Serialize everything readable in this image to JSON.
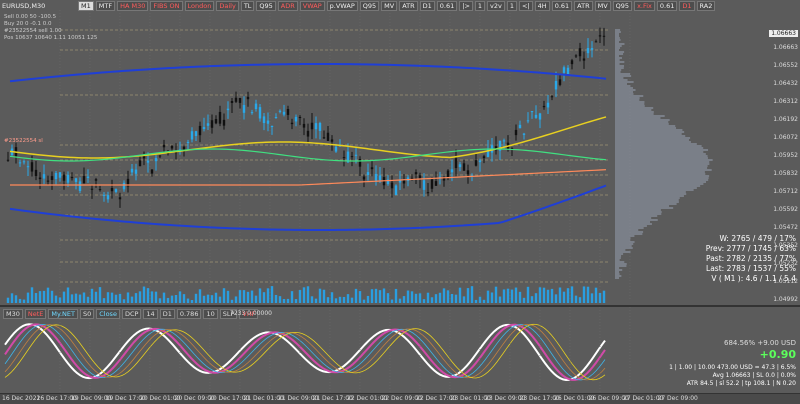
{
  "symbol": "EURUSD,M30",
  "toolbar": [
    {
      "label": "M1",
      "style": "white"
    },
    {
      "label": "MTF",
      "style": ""
    },
    {
      "label": "HA M30",
      "style": "red"
    },
    {
      "label": "FIBS ON",
      "style": "red"
    },
    {
      "label": "London",
      "style": "red"
    },
    {
      "label": "Daily",
      "style": "red"
    },
    {
      "label": "TL",
      "style": ""
    },
    {
      "label": "Q95",
      "style": ""
    },
    {
      "label": "ADR",
      "style": "red"
    },
    {
      "label": "VWAP",
      "style": "red"
    },
    {
      "label": "p.VWAP",
      "style": ""
    },
    {
      "label": "Q95",
      "style": ""
    },
    {
      "label": "MV",
      "style": ""
    },
    {
      "label": "ATR",
      "style": ""
    },
    {
      "label": "D1",
      "style": ""
    },
    {
      "label": "0.61",
      "style": ""
    },
    {
      "label": "|>",
      "style": ""
    },
    {
      "label": "1",
      "style": ""
    },
    {
      "label": "v2v",
      "style": ""
    },
    {
      "label": "1",
      "style": ""
    },
    {
      "label": "<|",
      "style": ""
    },
    {
      "label": "4H",
      "style": ""
    },
    {
      "label": "0.61",
      "style": ""
    },
    {
      "label": "ATR",
      "style": ""
    },
    {
      "label": "MV",
      "style": ""
    },
    {
      "label": "Q95",
      "style": ""
    },
    {
      "label": "x.Fix",
      "style": "red"
    },
    {
      "label": "0.61",
      "style": ""
    },
    {
      "label": "D1",
      "style": "red"
    },
    {
      "label": "RA2",
      "style": ""
    }
  ],
  "info_lines": [
    "Sell   0.00  50  -100.5",
    "Buy    20  0  -0.1  0.0",
    "#23522554 sell 1.00",
    "Pos    10637  10640  1.11  10051  125"
  ],
  "order_label": "#23522554 sl",
  "current_price": "1.06663",
  "price_labels": [
    "1.06663",
    "1.06552",
    "1.06432",
    "1.06312",
    "1.06192",
    "1.06072",
    "1.05952",
    "1.05832",
    "1.05712",
    "1.05592",
    "1.05472",
    "1.05352",
    "1.05232",
    "1.05112",
    "1.04992"
  ],
  "stats": [
    "W: 2765 / 479 / 17%",
    "Prev: 2777 / 1745 / 63%",
    "Past: 2782 / 2135 / 77%",
    "Last: 2783 / 1537 / 55%",
    "V ( M1 ): 4.6 / 1.1 / 5.4"
  ],
  "indicator_bar": [
    {
      "label": "M30",
      "style": ""
    },
    {
      "label": "NetE",
      "style": "red"
    },
    {
      "label": "My.NET",
      "style": "cyan"
    },
    {
      "label": "S0",
      "style": ""
    },
    {
      "label": "Close",
      "style": "cyan"
    },
    {
      "label": "DCP",
      "style": ""
    },
    {
      "label": "14",
      "style": ""
    },
    {
      "label": "D1",
      "style": ""
    },
    {
      "label": "0.786",
      "style": ""
    },
    {
      "label": "10",
      "style": ""
    },
    {
      "label": "SLP",
      "style": ""
    },
    {
      "label": "VHF",
      "style": "red"
    }
  ],
  "indicator_value": "7233 0.00000",
  "pnl": {
    "pct_line": "684.56%   +9.00 USD",
    "big": "+0.90",
    "line1": "1  |  1.00  |  10.00  473.00 USD = 47.3  |  6.5%",
    "line2": "Avg 1.06663  |  SL 0.0  |  0.0%",
    "line3": "ATR 84.5  |  sl 52.2  |  tp 108.1  |  N 0.20"
  },
  "x_labels": [
    "16 Dec 2022",
    "16 Dec 17:00",
    "19 Dec 09:00",
    "19 Dec 17:00",
    "20 Dec 01:00",
    "20 Dec 09:00",
    "20 Dec 17:00",
    "21 Dec 01:00",
    "21 Dec 09:00",
    "21 Dec 17:00",
    "22 Dec 01:00",
    "22 Dec 09:00",
    "22 Dec 17:00",
    "23 Dec 01:00",
    "23 Dec 09:00",
    "23 Dec 17:00",
    "26 Dec 01:00",
    "26 Dec 09:00",
    "27 Dec 01:00",
    "27 Dec 09:00"
  ],
  "colors": {
    "bull": "#2aa8e8",
    "bear": "#111111",
    "ma_blue": "#1f3fd6",
    "ma_yellow": "#e8d020",
    "ma_green": "#40e080",
    "ma_orange": "#ff8a5a",
    "hist": "#4aa8e0",
    "level": "#c0b080",
    "grid": "#6a6a6a",
    "volume": "#2a9ee0"
  }
}
